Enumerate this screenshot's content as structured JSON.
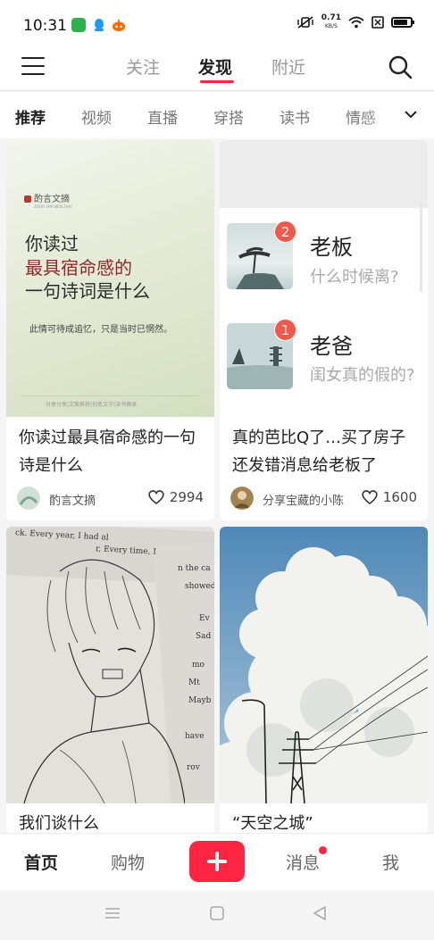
{
  "status_bar": {
    "time": "10:31",
    "net_speed_value": "0.71",
    "net_speed_unit": "KB/S",
    "battery_level": 0.85
  },
  "top_nav": {
    "tabs": [
      {
        "label": "关注",
        "active": false
      },
      {
        "label": "发现",
        "active": true
      },
      {
        "label": "附近",
        "active": false
      }
    ]
  },
  "categories": [
    "推荐",
    "视频",
    "直播",
    "穿搭",
    "读书",
    "情感"
  ],
  "active_category": "推荐",
  "feed": [
    {
      "title": "你读过最具宿命感的一句诗是什么",
      "author": "酌言文摘",
      "likes": "2994",
      "cover": {
        "brand": "酌言文摘",
        "brand_en": "ZHUO YAN WEN ZHAI",
        "lines": [
          "你读过",
          "最具宿命感的",
          "一句诗词是什么"
        ],
        "quote": "此情可待成追忆，只是当时已惘然。",
        "footer": "分享分享|文案推荐|创意文字|读书摘录"
      }
    },
    {
      "title": "真的芭比Q了…买了房子还发错消息给老板了",
      "author": "分享宝藏的小陈",
      "likes": "1600",
      "cover": {
        "chats": [
          {
            "name": "老板",
            "badge": "2",
            "message": "什么时候离?"
          },
          {
            "name": "老爸",
            "badge": "1",
            "message": "闺女真的假的?"
          }
        ]
      }
    },
    {
      "title": "我们谈什么",
      "cover": {
        "paper_lines": [
          "ck. Every year, I had al",
          "r, Every time, I",
          "n the ca",
          "showed",
          "Ev",
          "Sad",
          "mo",
          "Mt",
          "Mayb",
          "have",
          "rov"
        ]
      }
    },
    {
      "title": "“天空之城”"
    }
  ],
  "bottom_nav": {
    "items": [
      "首页",
      "购物",
      "消息",
      "我"
    ],
    "active": "首页",
    "unread_dot_on": "消息"
  },
  "colors": {
    "accent": "#ff2442",
    "badge": "#f2594b"
  }
}
